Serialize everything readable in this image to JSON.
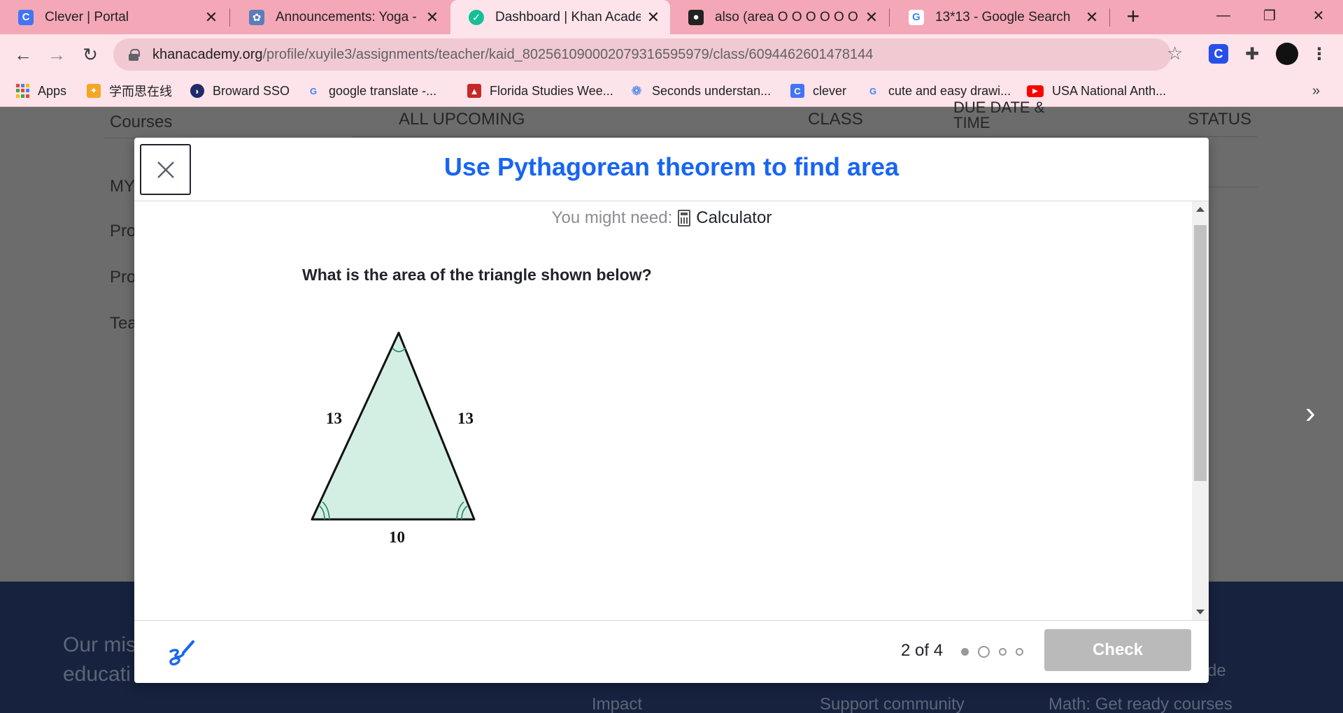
{
  "browser": {
    "tabs": [
      {
        "title": "Clever | Portal",
        "favicon": "clever-icon",
        "color": "#4274f6",
        "glyph": "C"
      },
      {
        "title": "Announcements: Yoga - Fec",
        "favicon": "classroom-icon",
        "color": "#5a7dbb",
        "glyph": "✿"
      },
      {
        "title": "Dashboard | Khan Academy",
        "favicon": "khan-academy-icon",
        "color": "#14bf96",
        "glyph": "⬡"
      },
      {
        "title": "also (area O O O O O O - B",
        "favicon": "search-engine-icon",
        "color": "#222222",
        "glyph": "●"
      },
      {
        "title": "13*13 - Google Search",
        "favicon": "google-icon",
        "color": "#ffffff",
        "glyph": "G"
      }
    ],
    "new_tab_label": "+",
    "url_host": "khanacademy.org",
    "url_path": "/profile/xuyile3/assignments/teacher/kaid_802561090002079316595979/class/6094462601478144",
    "bookmarks": [
      {
        "label": "Apps",
        "icon": "apps-grid-icon"
      },
      {
        "label": "学而思在线",
        "icon": "xueersi-icon"
      },
      {
        "label": "Broward SSO",
        "icon": "broward-icon"
      },
      {
        "label": "google translate -...",
        "icon": "google-icon"
      },
      {
        "label": "Florida Studies Wee...",
        "icon": "florida-icon"
      },
      {
        "label": "Seconds understan...",
        "icon": "paw-icon"
      },
      {
        "label": "clever",
        "icon": "clever-icon"
      },
      {
        "label": "cute and easy drawi...",
        "icon": "google-icon"
      },
      {
        "label": "USA National Anth...",
        "icon": "youtube-icon"
      }
    ],
    "bookmarks_more": "»"
  },
  "background": {
    "courses": "Courses",
    "col_upcoming": "ALL UPCOMING",
    "col_class": "CLASS",
    "col_due_1": "DUE DATE &",
    "col_due_2": "TIME",
    "col_status": "STATUS",
    "side_my": "MY",
    "side_pro1": "Pro",
    "side_pro2": "Pro",
    "side_tea": "Tea",
    "footer_mission_1": "Our mis",
    "footer_mission_2": "educati",
    "footer_impact": "Impact",
    "footer_support": "Support community",
    "footer_math": "Math: Get ready courses",
    "footer_de": "de"
  },
  "modal": {
    "title": "Use Pythagorean theorem to find area",
    "need_label": "You might need:",
    "need_tool": "Calculator",
    "question": "What is the area of the triangle shown below?",
    "figure": {
      "side_left": "13",
      "side_right": "13",
      "base": "10",
      "fill_color": "#d3efe4"
    },
    "progress": "2 of 4",
    "check_label": "Check",
    "accent_color": "#1865f2"
  }
}
